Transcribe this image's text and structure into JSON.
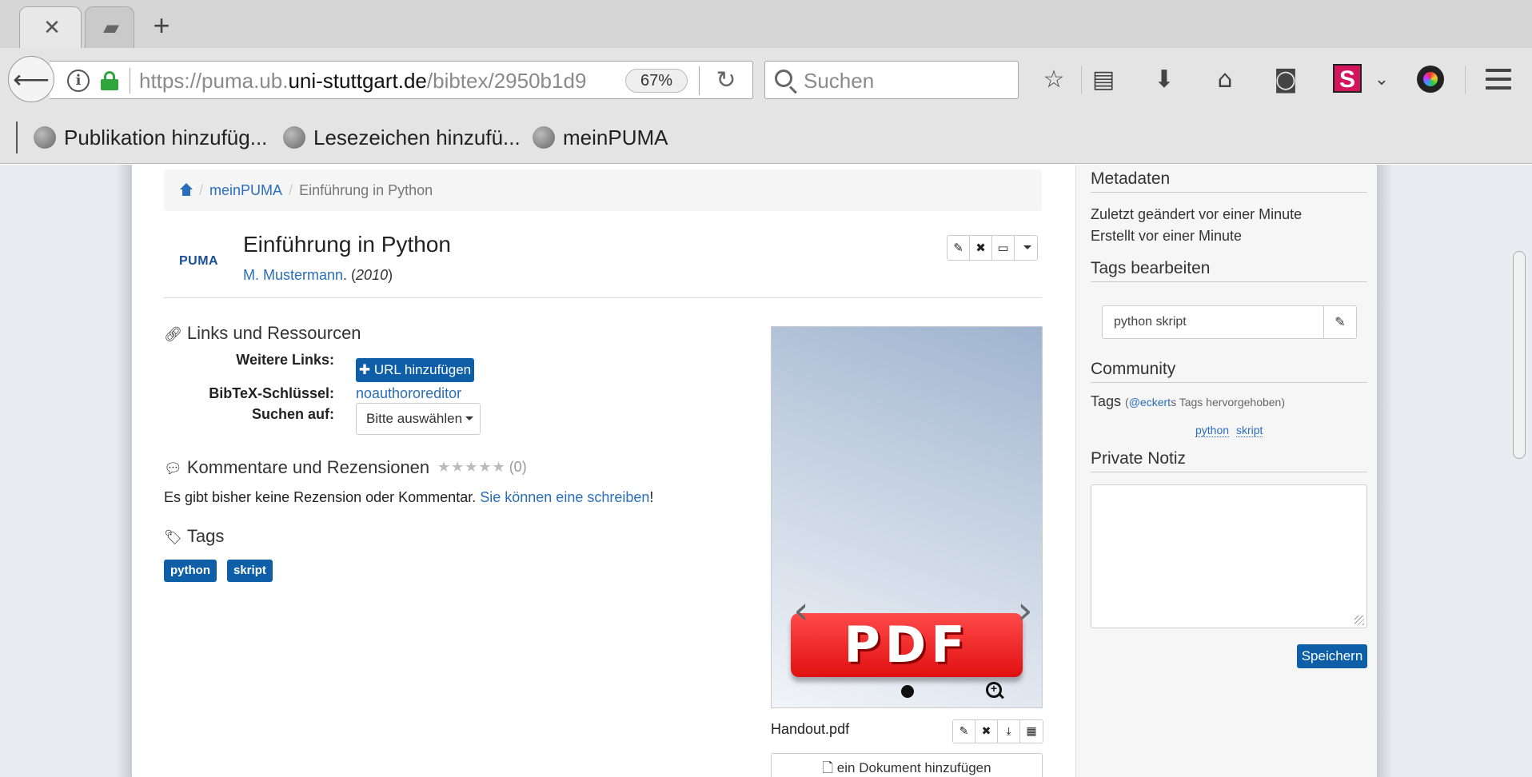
{
  "browser": {
    "tabs": [
      {
        "icon": "puma-favicon",
        "active": true
      },
      {
        "icon": "generic-page-icon",
        "active": false
      }
    ],
    "new_tab_label": "+",
    "url": {
      "prefix": "https://puma.ub.",
      "host": "uni-stuttgart.de",
      "path": "/bibtex/2950b1d9"
    },
    "zoom": "67%",
    "search_placeholder": "Suchen",
    "bookmarks": [
      {
        "label": "Publikation hinzufüg..."
      },
      {
        "label": "Lesezeichen hinzufü..."
      },
      {
        "label": "meinPUMA"
      }
    ]
  },
  "breadcrumb": {
    "items": [
      "meinPUMA",
      "Einführung in Python"
    ]
  },
  "publication": {
    "logo": "PUMA",
    "title": "Einführung in Python",
    "author": "M. Mustermann",
    "year": "2010"
  },
  "links_section": {
    "heading": "Links und Ressourcen",
    "further_links_label": "Weitere Links:",
    "add_url_button": "URL hinzufügen",
    "bibtex_key_label": "BibTeX-Schlüssel:",
    "bibtex_key_value": "noauthororeditor",
    "search_on_label": "Suchen auf:",
    "search_on_select": "Bitte auswählen"
  },
  "comments_section": {
    "heading": "Kommentare und Rezensionen",
    "rating_count": "(0)",
    "empty_text": "Es gibt bisher keine Rezension oder Kommentar.",
    "write_link": "Sie können eine schreiben",
    "end_punct": "!"
  },
  "tags_section": {
    "heading": "Tags",
    "tags": [
      "python",
      "skript"
    ]
  },
  "document": {
    "badge": "PDF",
    "filename": "Handout.pdf",
    "add_document": "ein Dokument hinzufügen"
  },
  "sidebar": {
    "metadata_heading": "Metadaten",
    "modified": "Zuletzt geändert vor einer Minute",
    "created": "Erstellt vor einer Minute",
    "edit_tags_heading": "Tags bearbeiten",
    "tags_input_value": "python skript",
    "community_heading": "Community",
    "community_tags_label": "Tags",
    "highlight_user": "@eckert",
    "highlight_suffix": "s Tags hervorgehoben)",
    "community_tags": [
      "python",
      "skript"
    ],
    "private_note_heading": "Private Notiz",
    "save_button": "Speichern"
  }
}
